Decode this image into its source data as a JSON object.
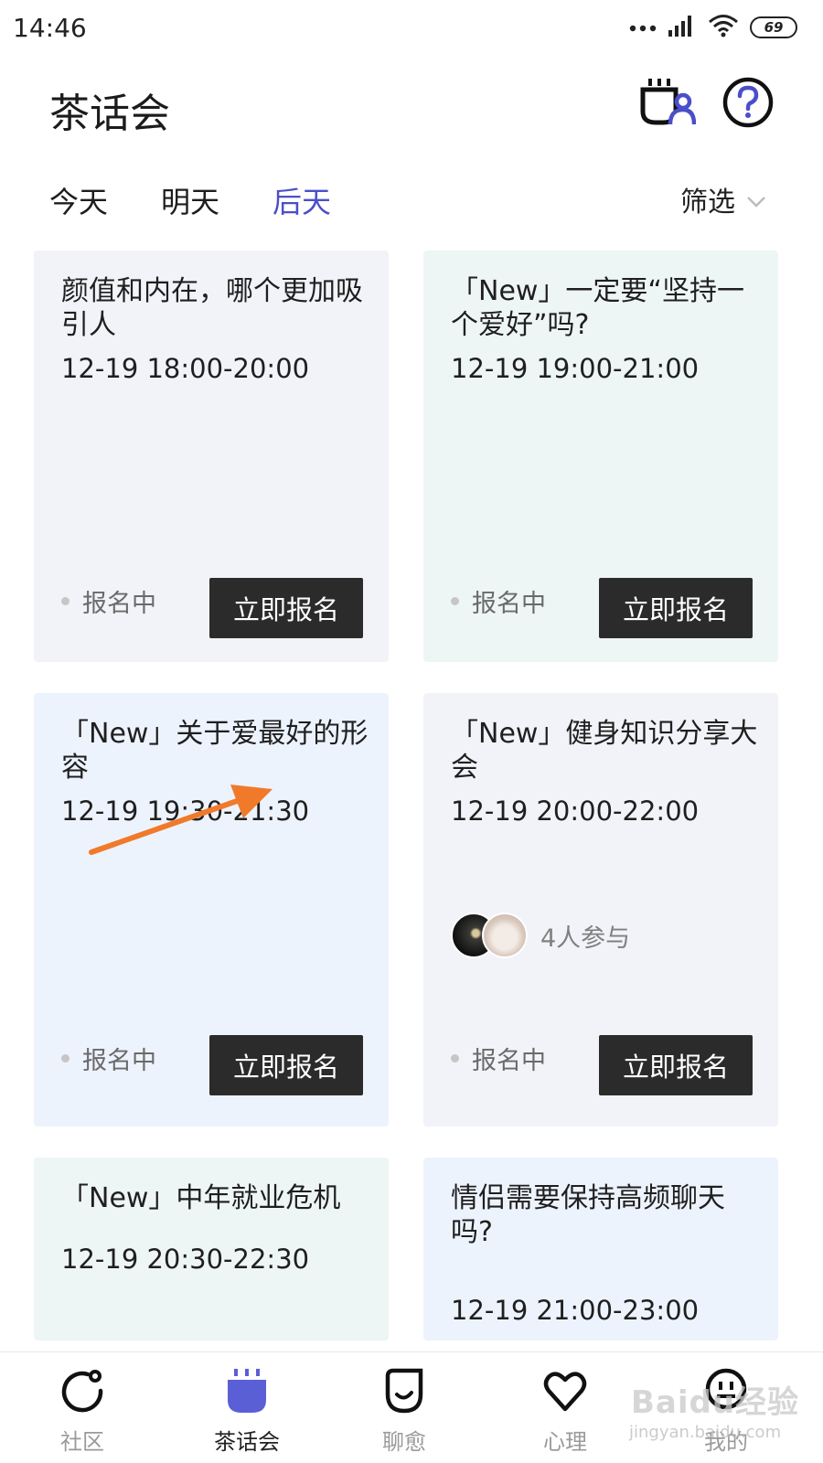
{
  "status_bar": {
    "time": "14:46",
    "battery": "69"
  },
  "header": {
    "title": "茶话会",
    "tea_icon": "tea-cup-person-icon",
    "help_icon": "question-circle-icon"
  },
  "tabs": {
    "today": "今天",
    "tomorrow": "明天",
    "day_after": "后天",
    "active": "后天",
    "filter": "筛选"
  },
  "cards": [
    {
      "title": "颜值和内在，哪个更加吸引人",
      "time": "12-19 18:00-20:00",
      "status": "报名中",
      "button": "立即报名"
    },
    {
      "title": "「New」一定要“坚持一个爱好”吗?",
      "time": "12-19 19:00-21:00",
      "status": "报名中",
      "button": "立即报名"
    },
    {
      "title": "「New」关于爱最好的形容",
      "time": "12-19 19:30-21:30",
      "status": "报名中",
      "button": "立即报名"
    },
    {
      "title": "「New」健身知识分享大会",
      "time": "12-19 20:00-22:00",
      "participants": "4人参与",
      "status": "报名中",
      "button": "立即报名"
    },
    {
      "title": "「New」中年就业危机",
      "time": "12-19 20:30-22:30"
    },
    {
      "title": "情侣需要保持高频聊天吗?",
      "time": "12-19 21:00-23:00"
    }
  ],
  "nav": {
    "items": [
      {
        "label": "社区",
        "icon": "community-icon"
      },
      {
        "label": "茶话会",
        "icon": "tea-party-icon"
      },
      {
        "label": "聊愈",
        "icon": "chat-heal-icon"
      },
      {
        "label": "心理",
        "icon": "heart-icon"
      },
      {
        "label": "我的",
        "icon": "profile-face-icon"
      }
    ],
    "active": "茶话会"
  },
  "watermark": {
    "main": "Baidu经验",
    "sub": "jingyan.baidu.com"
  },
  "colors": {
    "accent": "#4a4fc9",
    "button_bg": "#2b2b2b",
    "arrow": "#f07a2a"
  }
}
